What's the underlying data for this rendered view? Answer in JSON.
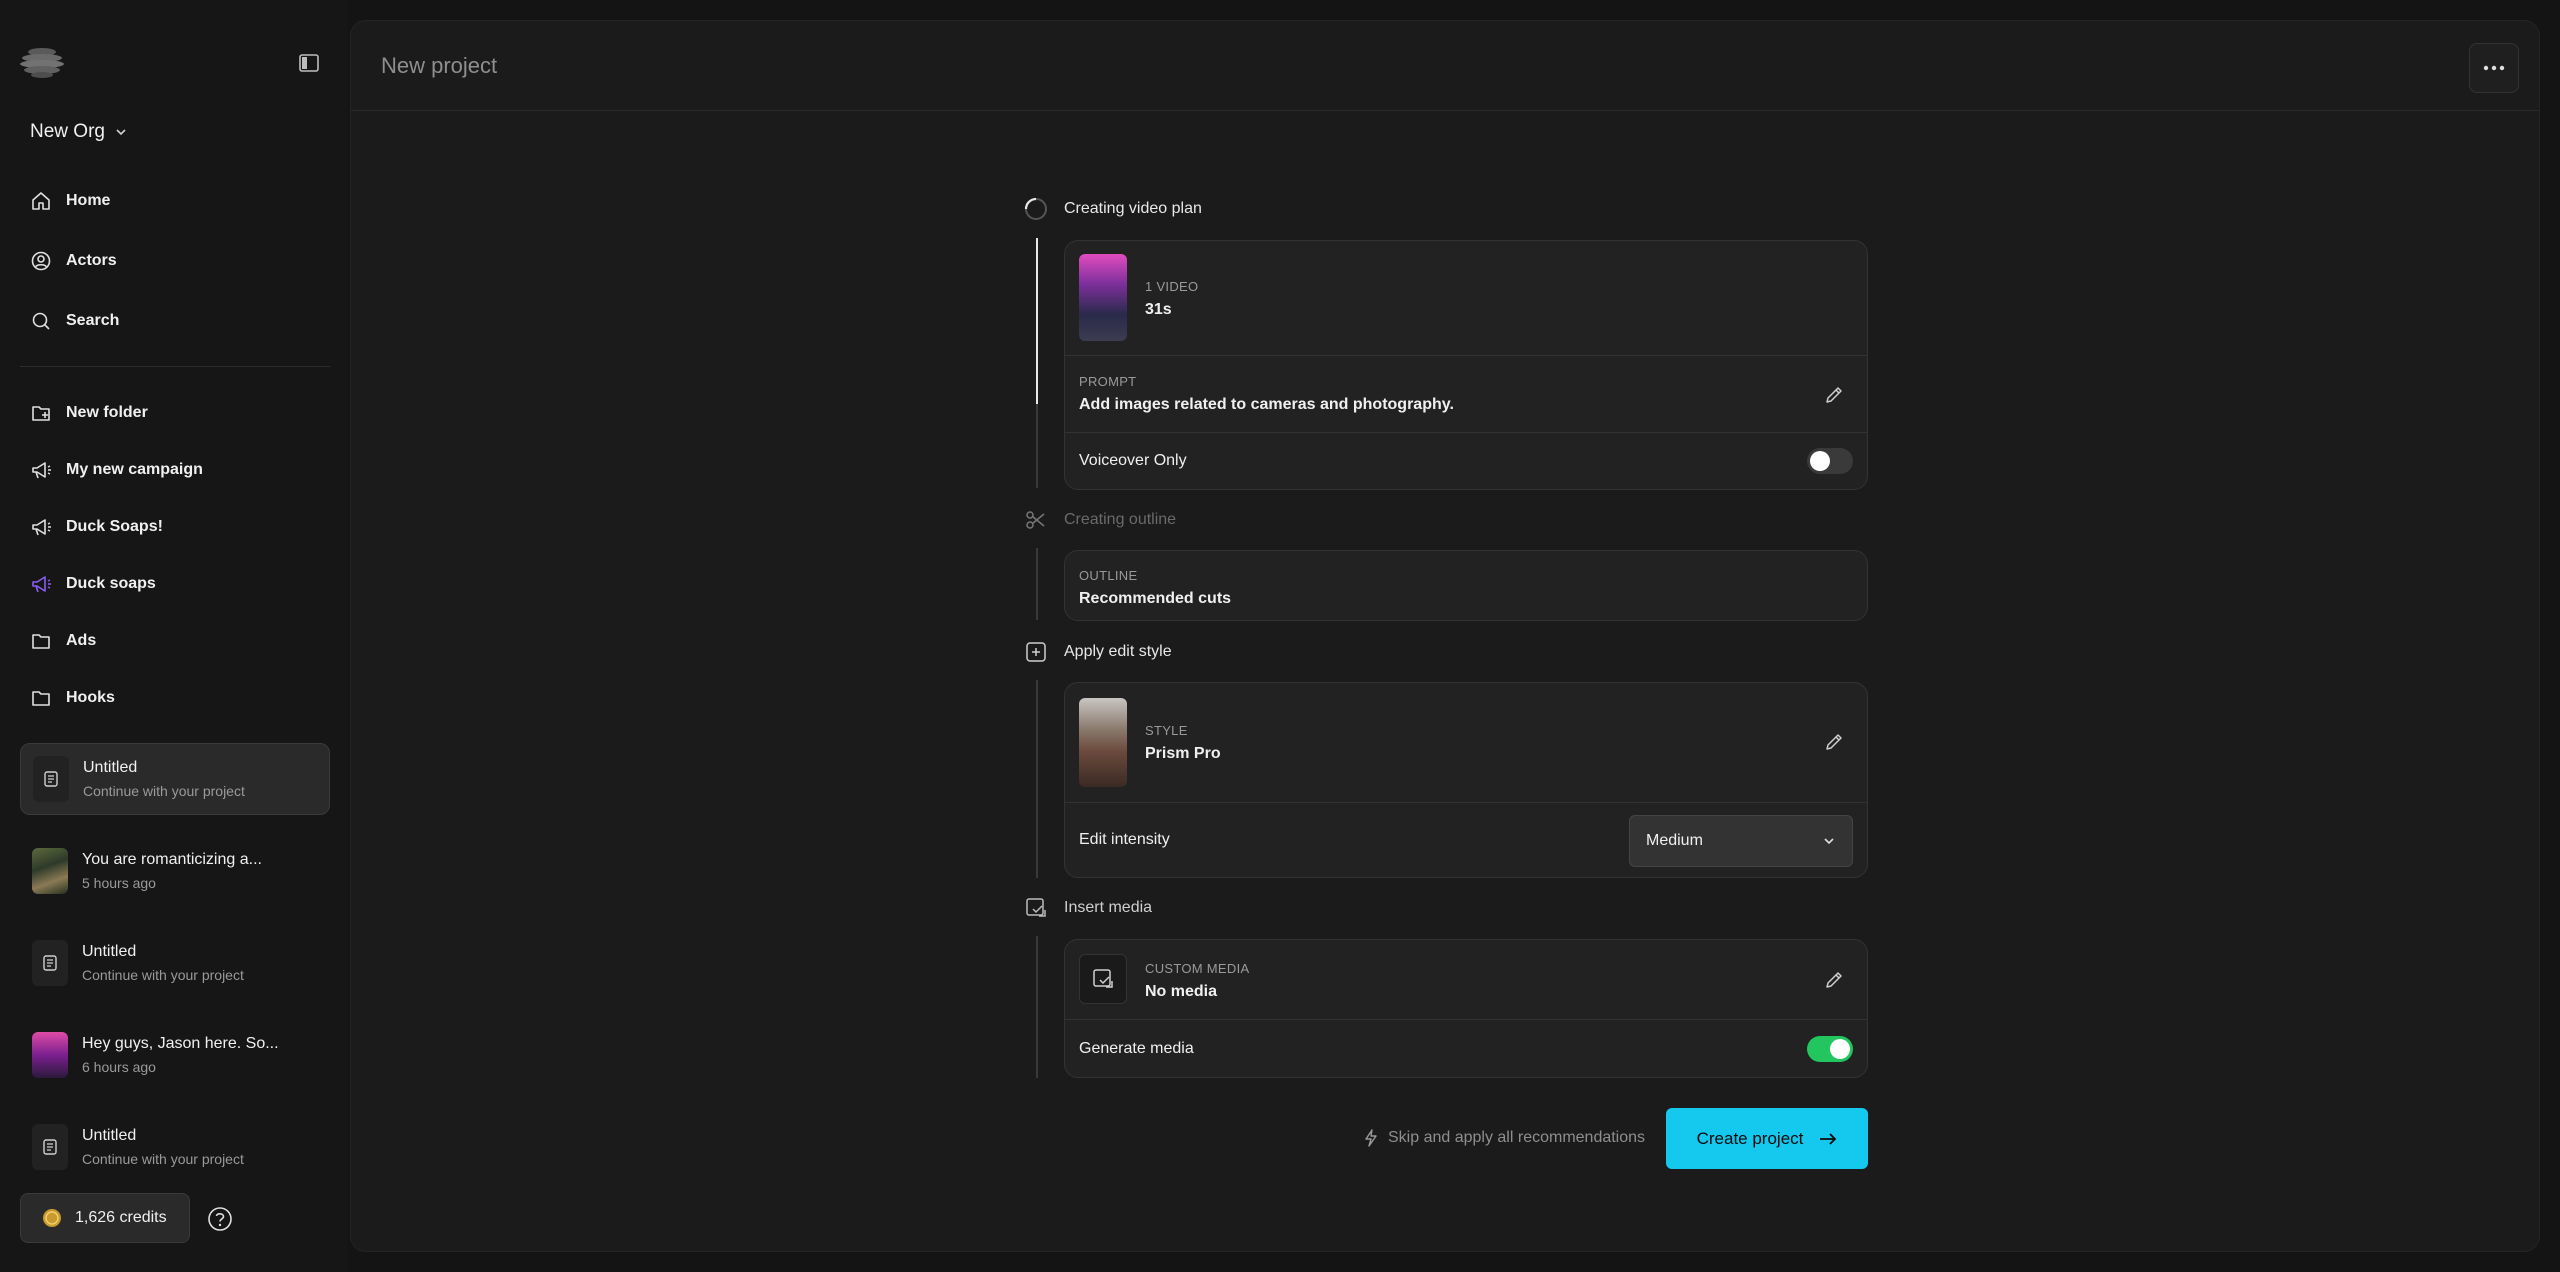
{
  "sidebar": {
    "org_name": "New Org",
    "nav": [
      {
        "label": "Home",
        "icon": "home-icon"
      },
      {
        "label": "Actors",
        "icon": "user-circle-icon"
      },
      {
        "label": "Search",
        "icon": "search-icon"
      }
    ],
    "folders": [
      {
        "label": "New folder",
        "icon": "folder-plus-icon"
      },
      {
        "label": "My new campaign",
        "icon": "megaphone-icon"
      },
      {
        "label": "Duck Soaps!",
        "icon": "megaphone-icon"
      },
      {
        "label": "Duck soaps",
        "icon": "megaphone-icon",
        "color": "#8b5cf6"
      },
      {
        "label": "Ads",
        "icon": "folder-icon"
      },
      {
        "label": "Hooks",
        "icon": "folder-icon"
      }
    ],
    "projects": [
      {
        "title": "Untitled",
        "subtitle": "Continue with your project",
        "active": true
      },
      {
        "title": "You are romanticizing a...",
        "subtitle": "5 hours ago"
      },
      {
        "title": "Untitled",
        "subtitle": "Continue with your project"
      },
      {
        "title": "Hey guys, Jason here. So...",
        "subtitle": "6 hours ago"
      },
      {
        "title": "Untitled",
        "subtitle": "Continue with your project"
      }
    ],
    "credits": "1,626 credits"
  },
  "header": {
    "title": "New project"
  },
  "steps": {
    "plan": {
      "label": "Creating video plan",
      "video_caption": "1 VIDEO",
      "video_duration": "31s",
      "prompt_caption": "PROMPT",
      "prompt_text": "Add images related to cameras and photography.",
      "voiceover_label": "Voiceover Only",
      "voiceover_on": false
    },
    "outline": {
      "label": "Creating outline",
      "caption": "OUTLINE",
      "value": "Recommended cuts"
    },
    "style": {
      "label": "Apply edit style",
      "caption": "STYLE",
      "value": "Prism Pro",
      "intensity_label": "Edit intensity",
      "intensity_value": "Medium"
    },
    "media": {
      "label": "Insert media",
      "caption": "CUSTOM MEDIA",
      "value": "No media",
      "generate_label": "Generate media",
      "generate_on": true
    }
  },
  "actions": {
    "skip_label": "Skip and apply all recommendations",
    "create_label": "Create project"
  },
  "colors": {
    "accent": "#14c8ee",
    "toggle_on": "#22c55e",
    "highlight_folder": "#8b5cf6"
  }
}
